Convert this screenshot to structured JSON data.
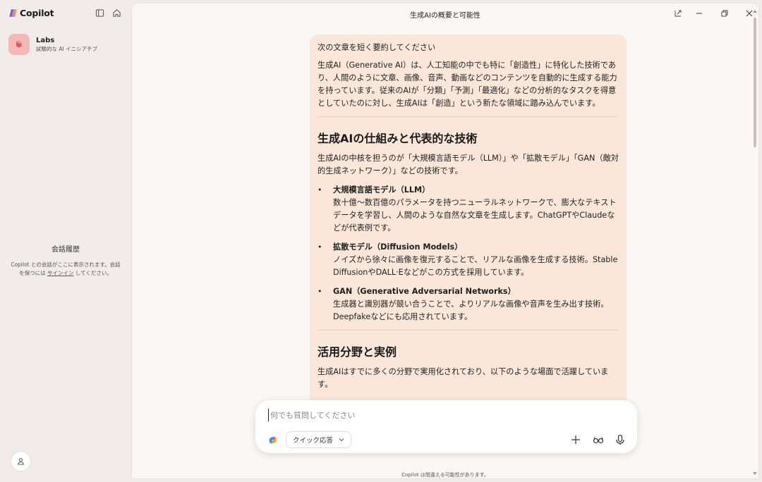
{
  "sidebar": {
    "brand": "Copilot",
    "labs_title": "Labs",
    "labs_subtitle": "試験的な AI イニシアチブ",
    "history_title": "会話履歴",
    "history_desc_pre": "Copilot との会話がここに表示されます。会話を保つには ",
    "signin_label": "サインイン",
    "history_desc_post": " してください。"
  },
  "window": {
    "title": "生成AIの概要と可能性"
  },
  "message": {
    "user_prompt": "次の文章を短く要約してください",
    "intro": "生成AI（Generative AI）は、人工知能の中でも特に「創造性」に特化した技術であり、人間のように文章、画像、音声、動画などのコンテンツを自動的に生成する能力を持っています。従来のAIが「分類」「予測」「最適化」などの分析的なタスクを得意としていたのに対し、生成AIは「創造」という新たな領域に踏み込んでいます。",
    "section1_heading": "生成AIの仕組みと代表的な技術",
    "section1_text": "生成AIの中核を担うのが「大規模言語モデル（LLM）」や「拡散モデル」「GAN（敵対的生成ネットワーク）」などの技術です。",
    "items": [
      {
        "title": "大規模言語モデル（LLM）",
        "desc": "数十億〜数百億のパラメータを持つニューラルネットワークで、膨大なテキストデータを学習し、人間のような自然な文章を生成します。ChatGPTやClaudeなどが代表例です。"
      },
      {
        "title": "拡散モデル（Diffusion Models）",
        "desc": "ノイズから徐々に画像を復元することで、リアルな画像を生成する技術。Stable DiffusionやDALL·Eなどがこの方式を採用しています。"
      },
      {
        "title": "GAN（Generative Adversarial Networks）",
        "desc": "生成器と識別器が競い合うことで、よりリアルな画像や音声を生み出す技術。Deepfakeなどにも応用されています。"
      }
    ],
    "section2_heading": "活用分野と実例",
    "section2_text": "生成AIはすでに多くの分野で実用化されており、以下のような場面で活躍しています。"
  },
  "composer": {
    "placeholder": "何でも質問してください",
    "mode_label": "クイック応答"
  },
  "footer": {
    "disclaimer": "Copilot は間違える可能性があります。"
  },
  "colors": {
    "bubble": "#fae7da",
    "sidebar": "#f1ecea",
    "main": "#faf7f4"
  }
}
